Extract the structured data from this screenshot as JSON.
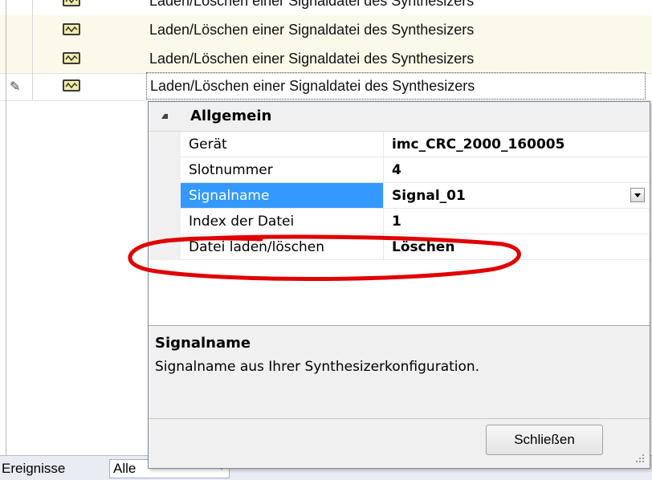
{
  "list": {
    "rows": [
      {
        "text": "Laden/Löschen einer Signaldatei des Synthesizers"
      },
      {
        "text": "Laden/Löschen einer Signaldatei des Synthesizers"
      },
      {
        "text": "Laden/Löschen einer Signaldatei des Synthesizers"
      },
      {
        "text": "Laden/Löschen einer Signaldatei des Synthesizers"
      }
    ]
  },
  "property_grid": {
    "category": "Allgemein",
    "properties": [
      {
        "name": "Gerät",
        "value": "imc_CRC_2000_160005"
      },
      {
        "name": "Slotnummer",
        "value": "4"
      },
      {
        "name": "Signalname",
        "value": "Signal_01"
      },
      {
        "name": "Index der Datei",
        "value": "1"
      },
      {
        "name": "Datei laden/löschen",
        "value": "Löschen"
      }
    ],
    "selected_property": "Signalname"
  },
  "description": {
    "title": "Signalname",
    "text": "Signalname aus Ihrer Synthesizerkonfiguration."
  },
  "buttons": {
    "close": "Schließen"
  },
  "bottom_bar": {
    "label": "Ereignisse",
    "filter_value": "Alle"
  },
  "colors": {
    "selection": "#3399ff",
    "annotation": "#e00000",
    "alt_row": "#fbf9ea"
  }
}
